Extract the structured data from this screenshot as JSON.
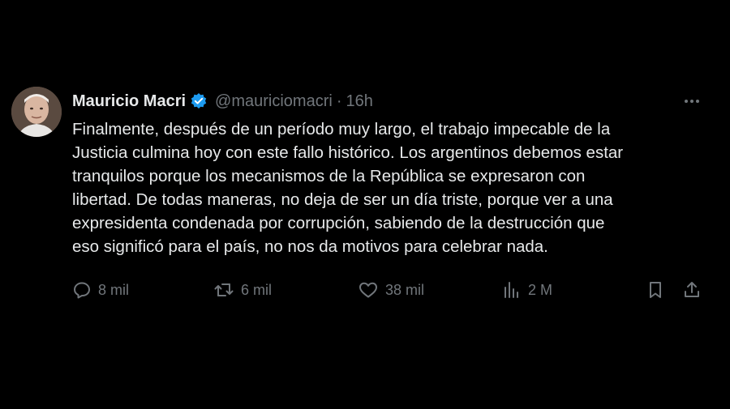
{
  "tweet": {
    "author_name": "Mauricio Macri",
    "handle": "@mauriciomacri",
    "separator": "·",
    "time": "16h",
    "text": "Finalmente, después de un período muy largo, el trabajo impecable de la\nJusticia culmina hoy con este fallo histórico. Los argentinos debemos estar\ntranquilos porque los mecanismos de la República se expresaron con\nlibertad. De todas maneras, no deja de ser un día triste, porque ver a una\nexpresidenta condenada por corrupción, sabiendo de la destrucción que\neso significó para el país, no nos da motivos para celebrar nada."
  },
  "actions": {
    "replies": "8 mil",
    "retweets": "6 mil",
    "likes": "38 mil",
    "views": "2 M"
  },
  "icons": {
    "verified": "verified-badge-icon",
    "more": "more-icon",
    "reply": "reply-icon",
    "retweet": "retweet-icon",
    "like": "heart-icon",
    "views": "views-icon",
    "bookmark": "bookmark-icon",
    "share": "share-icon"
  },
  "colors": {
    "background": "#000000",
    "text": "#e7e9ea",
    "secondary": "#71767b",
    "verified": "#1d9bf0"
  }
}
